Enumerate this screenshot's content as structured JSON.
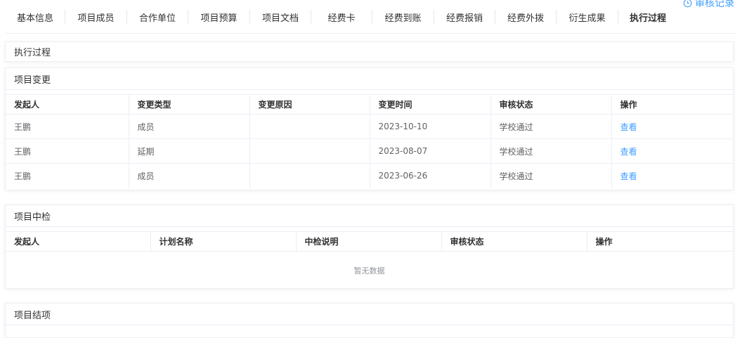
{
  "header": {
    "audit_label": "审核记录",
    "audit_icon": "clock-icon"
  },
  "tabs": [
    {
      "label": "基本信息"
    },
    {
      "label": "项目成员"
    },
    {
      "label": "合作单位"
    },
    {
      "label": "项目预算"
    },
    {
      "label": "项目文档"
    },
    {
      "label": "经费卡"
    },
    {
      "label": "经费到账"
    },
    {
      "label": "经费报销"
    },
    {
      "label": "经费外拨"
    },
    {
      "label": "衍生成果"
    },
    {
      "label": "执行过程"
    }
  ],
  "active_tab": "执行过程",
  "section_title": "执行过程",
  "change": {
    "title": "项目变更",
    "columns": [
      "发起人",
      "变更类型",
      "变更原因",
      "变更时间",
      "审核状态",
      "操作"
    ],
    "rows": [
      {
        "initiator": "王鹏",
        "type": "成员",
        "reason": "",
        "time": "2023-10-10",
        "status": "学校通过",
        "action": "查看"
      },
      {
        "initiator": "王鹏",
        "type": "延期",
        "reason": "",
        "time": "2023-08-07",
        "status": "学校通过",
        "action": "查看"
      },
      {
        "initiator": "王鹏",
        "type": "成员",
        "reason": "",
        "time": "2023-06-26",
        "status": "学校通过",
        "action": "查看"
      }
    ]
  },
  "midterm": {
    "title": "项目中检",
    "columns": [
      "发起人",
      "计划名称",
      "中检说明",
      "审核状态",
      "操作"
    ],
    "empty_text": "暂无数据"
  },
  "closing": {
    "title": "项目结项"
  },
  "colors": {
    "accent": "#409eff",
    "border": "#ebeef5",
    "text": "#303133",
    "muted": "#606266"
  }
}
